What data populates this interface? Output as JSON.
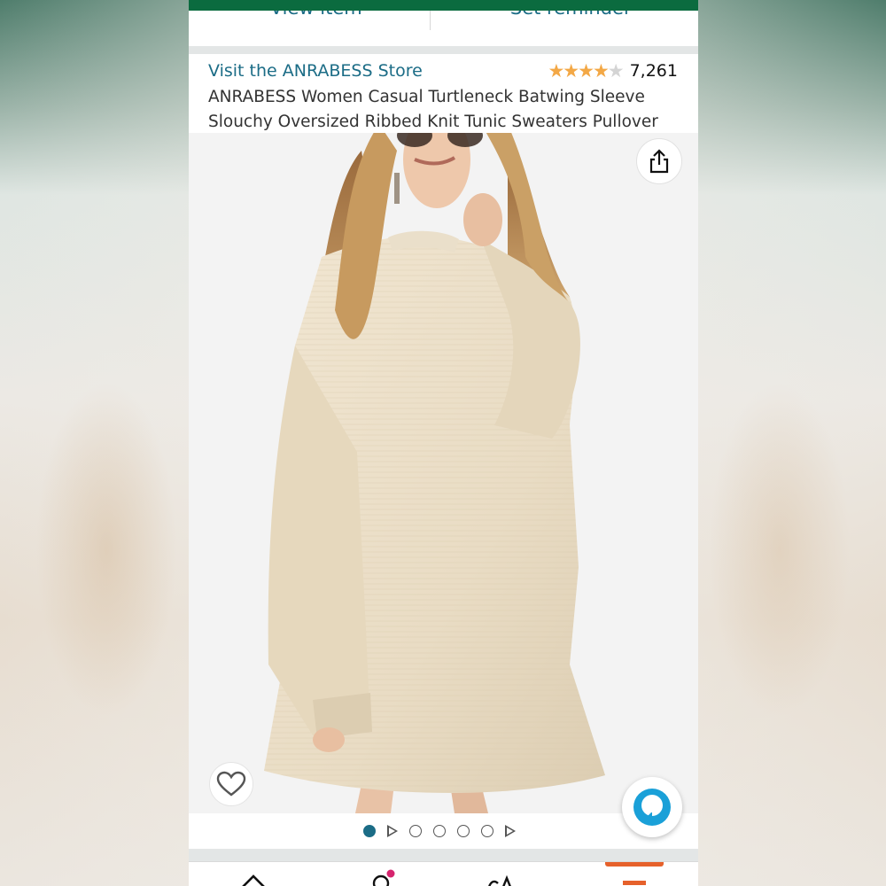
{
  "header": {
    "view_item_label": "View item",
    "set_reminder_label": "Set reminder"
  },
  "product": {
    "store_link": "Visit the ANRABESS Store",
    "rating_stars": 4,
    "rating_max": 5,
    "review_count": "7,261",
    "title": "ANRABESS Women Casual Turtleneck Batwing Sleeve Slouchy Oversized Ribbed Knit Tunic Sweaters Pullover"
  },
  "image_carousel": {
    "active_index": 0,
    "items": [
      "image",
      "video",
      "image",
      "image",
      "image",
      "image",
      "video"
    ]
  },
  "colors": {
    "brand_green": "#0b6b3f",
    "link_teal": "#1b6c86",
    "star_gold": "#f3a846",
    "cart_orange": "#e6612b",
    "alexa_blue": "#1aa0d8"
  },
  "icons": {
    "share": "share-icon",
    "wishlist": "heart-icon",
    "alexa": "alexa-icon",
    "home": "home-icon",
    "account": "account-icon",
    "inspire": "inspire-icon",
    "cart": "cart-icon"
  }
}
